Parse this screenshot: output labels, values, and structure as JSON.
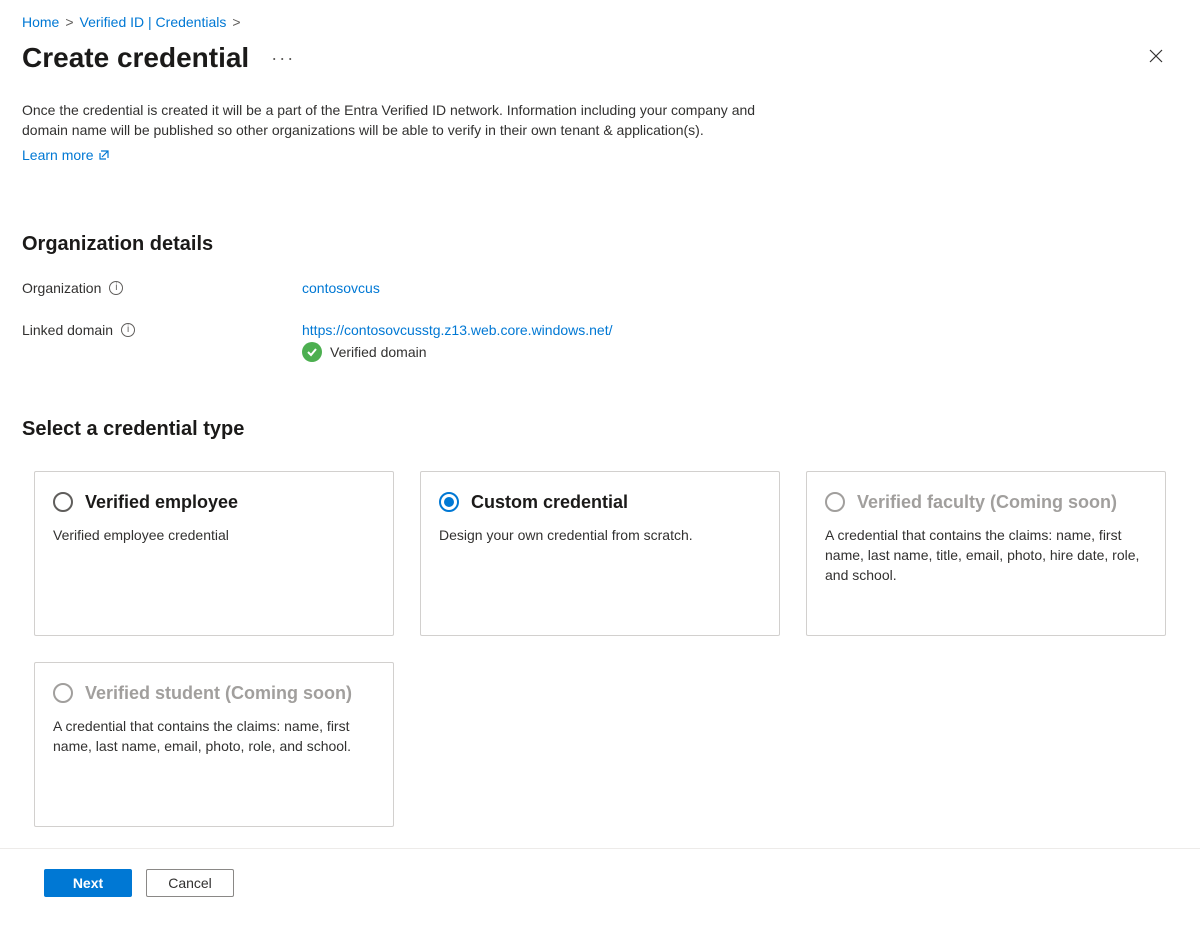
{
  "breadcrumb": {
    "home": "Home",
    "verified_id": "Verified ID | Credentials"
  },
  "page": {
    "title": "Create credential",
    "intro": "Once the credential is created it will be a part of the Entra Verified ID network. Information including your company and domain name will be published so other organizations will be able to verify in their own tenant & application(s).",
    "learn_more": "Learn more"
  },
  "org_section": {
    "heading": "Organization details",
    "organization_label": "Organization",
    "organization_value": "contosovcus",
    "linked_domain_label": "Linked domain",
    "linked_domain_value": "https://contosovcusstg.z13.web.core.windows.net/",
    "verified_text": "Verified domain"
  },
  "type_section": {
    "heading": "Select a credential type",
    "cards": [
      {
        "title": "Verified employee",
        "desc": "Verified employee credential",
        "selected": false,
        "enabled": true
      },
      {
        "title": "Custom credential",
        "desc": "Design your own credential from scratch.",
        "selected": true,
        "enabled": true
      },
      {
        "title": "Verified faculty (Coming soon)",
        "desc": "A credential that contains the claims: name, first name, last name, title, email, photo, hire date, role, and school.",
        "selected": false,
        "enabled": false
      },
      {
        "title": "Verified student (Coming soon)",
        "desc": "A credential that contains the claims: name, first name, last name, email, photo, role, and school.",
        "selected": false,
        "enabled": false
      }
    ]
  },
  "footer": {
    "next": "Next",
    "cancel": "Cancel"
  }
}
